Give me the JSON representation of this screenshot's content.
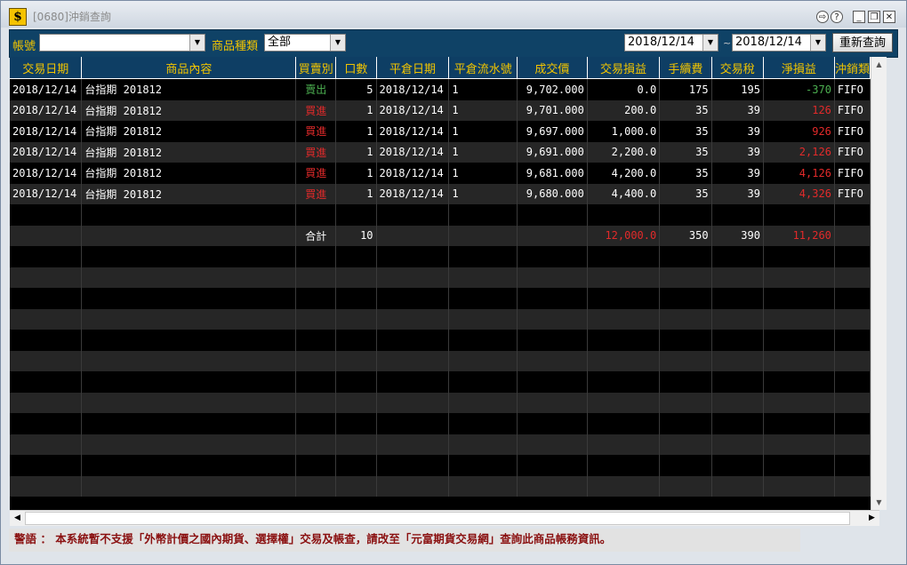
{
  "window": {
    "title": "[0680]沖銷查詢",
    "app_icon": "dollar-icon"
  },
  "toolbar": {
    "account_label": "帳號",
    "account_value": "",
    "product_type_label": "商品種類",
    "product_type_value": "全部",
    "date_from": "2018/12/14",
    "date_sep": "~",
    "date_to": "2018/12/14",
    "requery_label": "重新查詢"
  },
  "table": {
    "columns": [
      "交易日期",
      "商品內容",
      "買賣別",
      "口數",
      "平倉日期",
      "平倉流水號",
      "成交價",
      "交易損益",
      "手續費",
      "交易稅",
      "淨損益",
      "沖銷類"
    ],
    "rows": [
      [
        "2018/12/14",
        "台指期 201812",
        "賣出",
        "5",
        "2018/12/14",
        "1",
        "9,702.000",
        "0.0",
        "175",
        "195",
        "-370",
        "FIFO"
      ],
      [
        "2018/12/14",
        "台指期 201812",
        "買進",
        "1",
        "2018/12/14",
        "1",
        "9,701.000",
        "200.0",
        "35",
        "39",
        "126",
        "FIFO"
      ],
      [
        "2018/12/14",
        "台指期 201812",
        "買進",
        "1",
        "2018/12/14",
        "1",
        "9,697.000",
        "1,000.0",
        "35",
        "39",
        "926",
        "FIFO"
      ],
      [
        "2018/12/14",
        "台指期 201812",
        "買進",
        "1",
        "2018/12/14",
        "1",
        "9,691.000",
        "2,200.0",
        "35",
        "39",
        "2,126",
        "FIFO"
      ],
      [
        "2018/12/14",
        "台指期 201812",
        "買進",
        "1",
        "2018/12/14",
        "1",
        "9,681.000",
        "4,200.0",
        "35",
        "39",
        "4,126",
        "FIFO"
      ],
      [
        "2018/12/14",
        "台指期 201812",
        "買進",
        "1",
        "2018/12/14",
        "1",
        "9,680.000",
        "4,400.0",
        "35",
        "39",
        "4,326",
        "FIFO"
      ]
    ],
    "totals": {
      "label": "合計",
      "qty": "10",
      "pl": "12,000.0",
      "fee": "350",
      "tax": "390",
      "net": "11,260"
    }
  },
  "warning": "警語 ： 本系統暫不支援「外幣計價之國內期貨、選擇權」交易及帳查，請改至「元富期貨交易網」查詢此商品帳務資訊。",
  "colors": {
    "header_bg": "#0e3e64",
    "header_text": "#f1c400",
    "buy": "#e22a2a",
    "sell": "#4caf50",
    "loss": "#4caf50",
    "profit": "#e22a2a"
  }
}
